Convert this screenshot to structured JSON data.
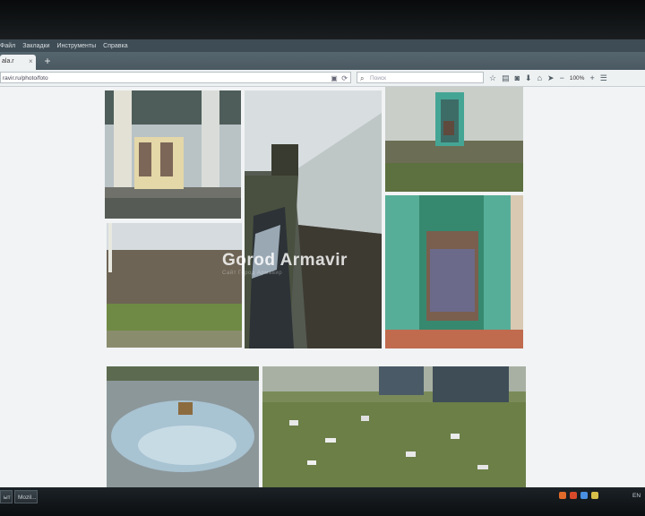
{
  "menu": {
    "items": [
      "Файл",
      "Закладки",
      "Инструменты",
      "Справка"
    ]
  },
  "tab": {
    "label": "ala.r",
    "close": "×"
  },
  "new_tab_label": "+",
  "address_bar": {
    "url": "ravir.ru/photo/foto"
  },
  "search_bar": {
    "placeholder": "Поиск"
  },
  "toolbar": {
    "zoom": "100%"
  },
  "watermark": {
    "text": "Gorod Armavir",
    "subtitle": "Сайт Город Армавир"
  },
  "taskbar": {
    "items": [
      "ыт",
      "Mozil..."
    ],
    "language": "EN"
  },
  "colors": {
    "menubar": "#3e4c55",
    "page": "#f1f3f4",
    "taskbar": "#0b0e10"
  }
}
